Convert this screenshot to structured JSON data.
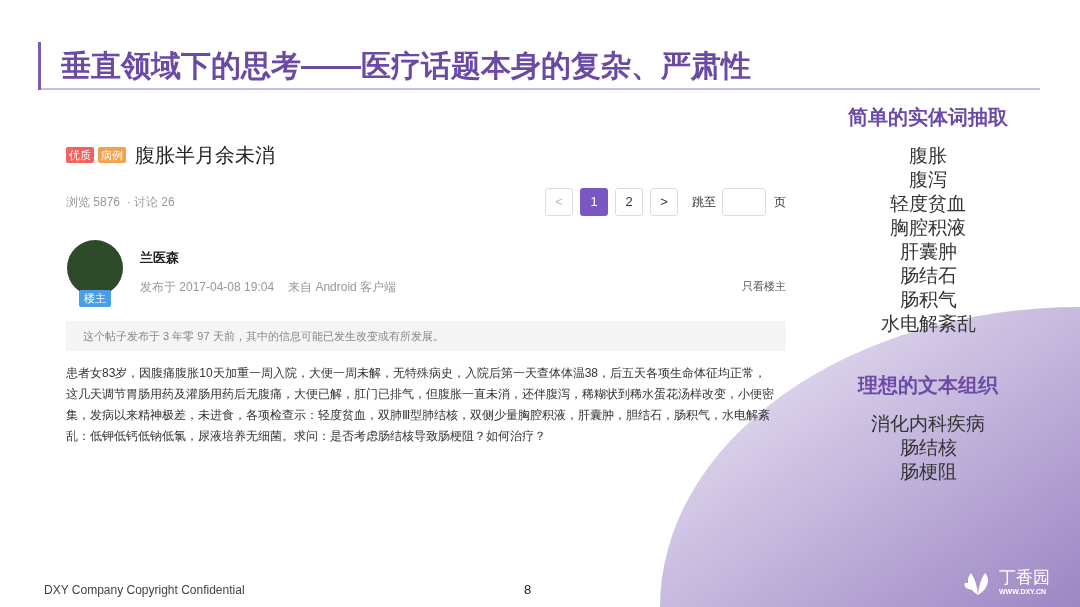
{
  "slide_title": "垂直领域下的思考——医疗话题本身的复杂、严肃性",
  "post": {
    "tags": [
      {
        "label": "优质",
        "color": "#f0625c"
      },
      {
        "label": "病例",
        "color": "#f5a04a"
      }
    ],
    "title": "腹胀半月余未消",
    "stats": "浏览 5876  · 讨论 26",
    "pagination": {
      "prev": "<",
      "pages": [
        {
          "label": "1",
          "selected": true
        },
        {
          "label": "2",
          "selected": false
        }
      ],
      "next": ">",
      "jump_label": "跳至",
      "page_unit": "页"
    },
    "author": {
      "name": "兰医森",
      "badge": "楼主",
      "posted": "发布于 2017-04-08 19:04",
      "source": "来自 Android 客户端",
      "filter": "只看楼主"
    },
    "notice": "这个帖子发布于 3 年零 97 天前，其中的信息可能已发生改变或有所发展。",
    "body": "患者女83岁，因腹痛腹胀10天加重一周入院，大便一周未解，无特殊病史，入院后第一天查体体温38，后五天各项生命体征均正常，这几天调节胃肠用药及灌肠用药后无腹痛，大便已解，肛门已排气，但腹胀一直未消，还伴腹泻，稀糊状到稀水蛋花汤样改变，小便密集，发病以来精神极差，未进食，各项检查示：轻度贫血，双肺Ⅲ型肺结核，双侧少量胸腔积液，肝囊肿，胆结石，肠积气，水电解紊乱：低钾低钙低钠低氯，尿液培养无细菌。求问：是否考虑肠结核导致肠梗阻？如何治疗？"
  },
  "sections": [
    {
      "heading": "简单的实体词抽取",
      "items": [
        "腹胀",
        "腹泻",
        "轻度贫血",
        "胸腔积液",
        "肝囊肿",
        "肠结石",
        "肠积气",
        "水电解紊乱"
      ]
    },
    {
      "heading": "理想的文本组织",
      "items": [
        "消化内科疾病",
        "肠结核",
        "肠梗阻"
      ]
    }
  ],
  "footer": {
    "copyright": "DXY Company Copyright Confidential",
    "page_number": "8",
    "logo_text": "丁香园",
    "logo_url": "WWW.DXY.CN"
  }
}
